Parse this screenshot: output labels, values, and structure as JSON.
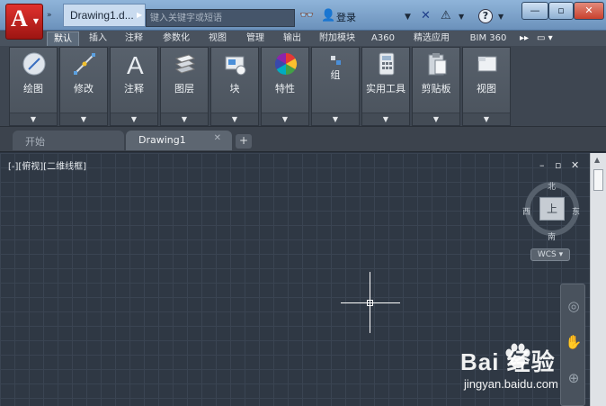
{
  "titlebar": {
    "app_logo": "A",
    "document_tab": "Drawing1.d...",
    "search_placeholder": "键入关键字或短语",
    "login_label": "登录",
    "window_controls": [
      "—",
      "▫",
      "✕"
    ]
  },
  "ribbon_tabs": [
    "默认",
    "插入",
    "注释",
    "参数化",
    "视图",
    "管理",
    "输出",
    "附加模块",
    "A360",
    "精选应用",
    "BIM 360"
  ],
  "active_ribbon_tab": "默认",
  "ribbon_panels": [
    {
      "label": "绘图",
      "icon": "draw-icon"
    },
    {
      "label": "修改",
      "icon": "modify-icon"
    },
    {
      "label": "注释",
      "icon": "annotation-icon"
    },
    {
      "label": "图层",
      "icon": "layers-icon"
    },
    {
      "label": "块",
      "icon": "block-icon"
    },
    {
      "label": "特性",
      "icon": "properties-icon"
    },
    {
      "label": "组",
      "icon": "group-icon"
    },
    {
      "label": "实用工具",
      "icon": "utilities-icon"
    },
    {
      "label": "剪贴板",
      "icon": "clipboard-icon"
    },
    {
      "label": "视图",
      "icon": "view-icon"
    }
  ],
  "file_tabs": {
    "start": "开始",
    "drawing": "Drawing1",
    "close": "✕",
    "add": "+"
  },
  "viewport": {
    "label": "[-][俯视][二维线框]",
    "controls": [
      "–",
      "▫",
      "✕"
    ]
  },
  "viewcube": {
    "face": "上",
    "north": "北",
    "south": "南",
    "east": "东",
    "west": "西",
    "wcs": "WCS ▾"
  },
  "watermark": {
    "brand": "Bai  经验",
    "url": "jingyan.baidu.com"
  }
}
